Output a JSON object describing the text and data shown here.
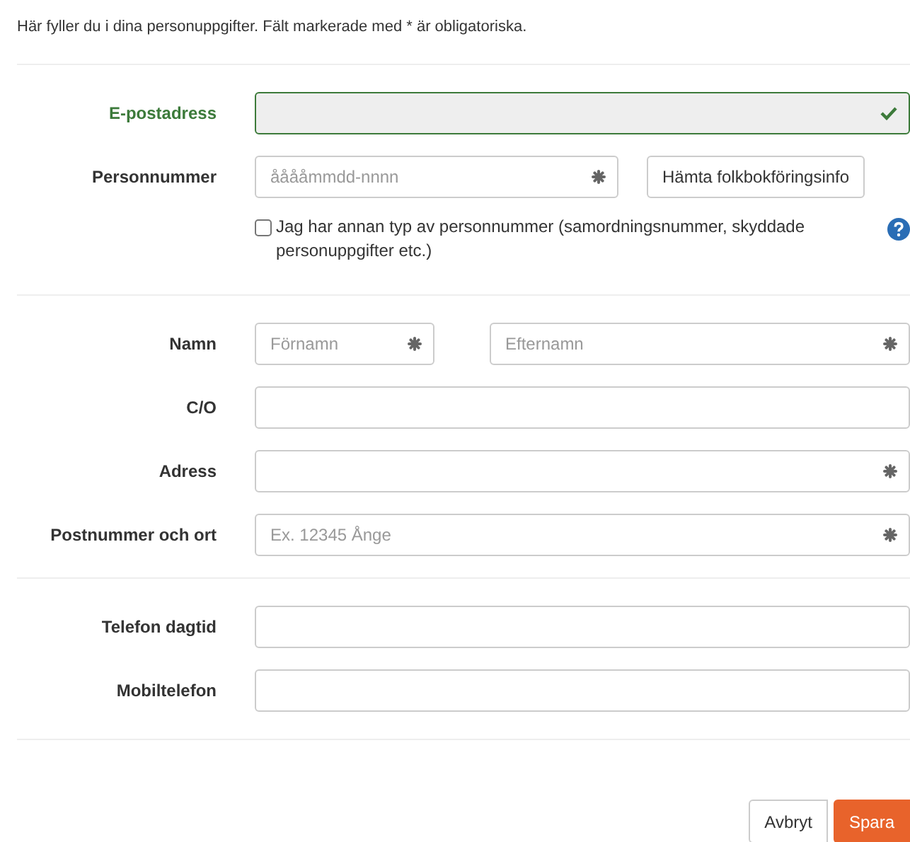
{
  "intro": "Här fyller du i dina personuppgifter. Fält markerade med * är obligatoriska.",
  "sections": [
    {
      "rows": [
        {
          "kind": "single",
          "label": "E-postadress",
          "valid": true,
          "inputs": [
            {
              "required": false
            }
          ]
        },
        {
          "kind": "with_button",
          "label": "Personnummer",
          "valid": false,
          "inputs": [
            {
              "placeholder": "ååååmmdd-nnnn",
              "required": true
            }
          ],
          "button": "Hämta folkbokföringsinfo",
          "checkbox": {
            "label": "Jag har annan typ av personnummer (samordningsnummer, skyddade personuppgifter etc.)",
            "checked": false
          }
        }
      ]
    },
    {
      "rows": [
        {
          "kind": "split",
          "label": "Namn",
          "valid": false,
          "inputs": [
            {
              "placeholder": "Förnamn",
              "required": true
            },
            {
              "placeholder": "Efternamn",
              "required": true
            }
          ]
        },
        {
          "kind": "single",
          "label": "C/O",
          "valid": false,
          "inputs": [
            {
              "required": false
            }
          ]
        },
        {
          "kind": "single",
          "label": "Adress",
          "valid": false,
          "inputs": [
            {
              "required": true
            }
          ]
        },
        {
          "kind": "single",
          "label": "Postnummer och ort",
          "valid": false,
          "inputs": [
            {
              "placeholder": "Ex. 12345 Ånge",
              "required": true
            }
          ]
        }
      ]
    },
    {
      "rows": [
        {
          "kind": "single",
          "label": "Telefon dagtid",
          "valid": false,
          "inputs": [
            {
              "required": false
            }
          ]
        },
        {
          "kind": "single",
          "label": "Mobiltelefon",
          "valid": false,
          "inputs": [
            {
              "required": false
            }
          ]
        }
      ]
    }
  ],
  "buttons": [
    {
      "label": "Avbryt",
      "kind": "secondary"
    },
    {
      "label": "Spara",
      "kind": "primary"
    }
  ]
}
